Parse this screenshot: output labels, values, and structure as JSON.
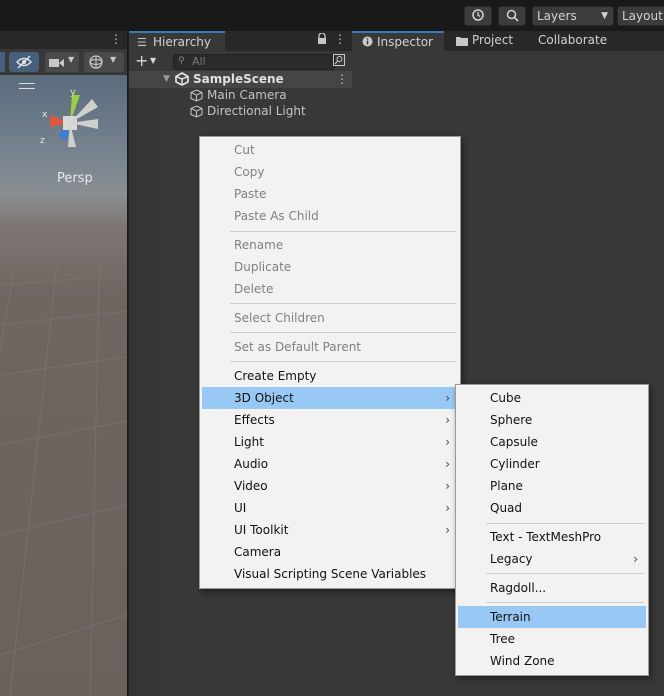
{
  "toolbar": {
    "layers_label": "Layers",
    "layout_label": "Layout"
  },
  "scene_view": {
    "persp_label": "Persp",
    "gizmo_axes": {
      "y": "y",
      "x": "x",
      "z": "z"
    }
  },
  "hierarchy": {
    "tab_label": "Hierarchy",
    "search_placeholder": "All",
    "scene_name": "SampleScene",
    "objects": [
      {
        "label": "Main Camera"
      },
      {
        "label": "Directional Light"
      }
    ]
  },
  "inspector": {
    "tabs": [
      {
        "label": "Inspector"
      },
      {
        "label": "Project"
      },
      {
        "label": "Collaborate"
      }
    ]
  },
  "context_menu": {
    "items": [
      {
        "label": "Cut"
      },
      {
        "label": "Copy"
      },
      {
        "label": "Paste"
      },
      {
        "label": "Paste As Child"
      },
      {
        "label": "Rename"
      },
      {
        "label": "Duplicate"
      },
      {
        "label": "Delete"
      },
      {
        "label": "Select Children"
      },
      {
        "label": "Set as Default Parent"
      },
      {
        "label": "Create Empty"
      },
      {
        "label": "3D Object"
      },
      {
        "label": "Effects"
      },
      {
        "label": "Light"
      },
      {
        "label": "Audio"
      },
      {
        "label": "Video"
      },
      {
        "label": "UI"
      },
      {
        "label": "UI Toolkit"
      },
      {
        "label": "Camera"
      },
      {
        "label": "Visual Scripting Scene Variables"
      }
    ]
  },
  "submenu_3d": {
    "items": [
      {
        "label": "Cube"
      },
      {
        "label": "Sphere"
      },
      {
        "label": "Capsule"
      },
      {
        "label": "Cylinder"
      },
      {
        "label": "Plane"
      },
      {
        "label": "Quad"
      },
      {
        "label": "Text - TextMeshPro"
      },
      {
        "label": "Legacy"
      },
      {
        "label": "Ragdoll..."
      },
      {
        "label": "Terrain"
      },
      {
        "label": "Tree"
      },
      {
        "label": "Wind Zone"
      }
    ]
  },
  "colors": {
    "highlight": "#98c9f4",
    "tab_accent": "#3a79bb",
    "panel_bg": "#383838"
  }
}
